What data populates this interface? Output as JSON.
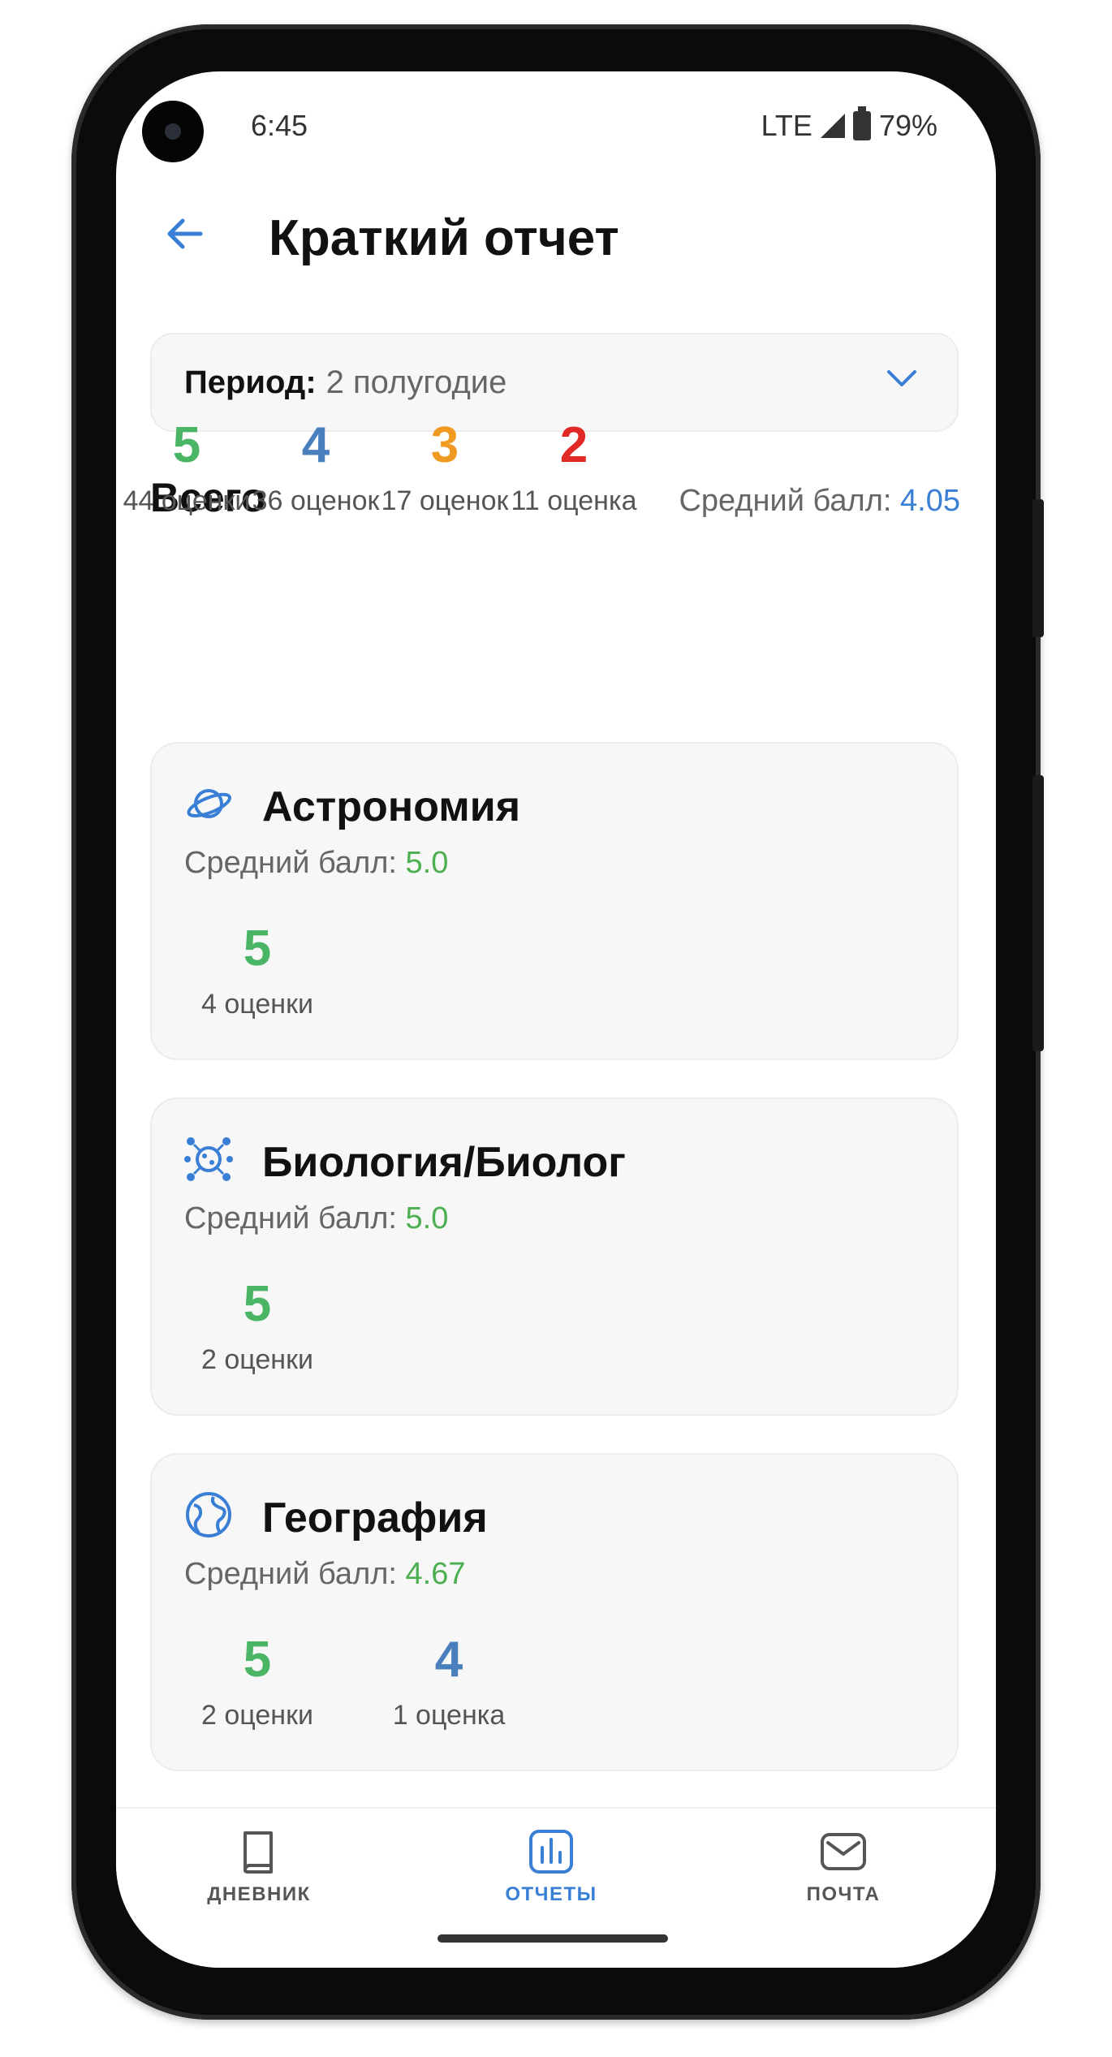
{
  "status": {
    "time": "6:45",
    "network": "LTE",
    "battery": "79%"
  },
  "header": {
    "title": "Краткий отчет"
  },
  "period": {
    "label": "Период:",
    "value": "2 полугодие"
  },
  "summary": {
    "label": "Всего",
    "avg_label": "Средний балл:",
    "avg_value": "4.05",
    "grades": [
      {
        "grade": "5",
        "count": "44 оценки",
        "color": "#4bb566"
      },
      {
        "grade": "4",
        "count": "36 оценок",
        "color": "#4a7fbd"
      },
      {
        "grade": "3",
        "count": "17 оценок",
        "color": "#f19a21"
      },
      {
        "grade": "2",
        "count": "11 оценка",
        "color": "#e12a25"
      }
    ]
  },
  "subjects": [
    {
      "name": "Астрономия",
      "icon": "planet-icon",
      "avg_label": "Средний балл:",
      "avg_value": "5.0",
      "grades": [
        {
          "grade": "5",
          "count": "4 оценки"
        }
      ]
    },
    {
      "name": "Биология/Биолог",
      "icon": "cell-icon",
      "avg_label": "Средний балл:",
      "avg_value": "5.0",
      "grades": [
        {
          "grade": "5",
          "count": "2 оценки"
        }
      ]
    },
    {
      "name": "География",
      "icon": "globe-icon",
      "avg_label": "Средний балл:",
      "avg_value": "4.67",
      "grades": [
        {
          "grade": "5",
          "count": "2 оценки"
        },
        {
          "grade": "4",
          "count": "1 оценка"
        }
      ]
    }
  ],
  "nav": [
    {
      "label": "ДНЕВНИК",
      "icon": "book-icon"
    },
    {
      "label": "ОТЧЕТЫ",
      "icon": "chart-icon",
      "active": true
    },
    {
      "label": "ПОЧТА",
      "icon": "mail-icon"
    }
  ],
  "colors": {
    "accent": "#3a7fd6",
    "grade5": "#4bb566",
    "grade4": "#4a7fbd",
    "grade3": "#f19a21",
    "grade2": "#e12a25"
  }
}
